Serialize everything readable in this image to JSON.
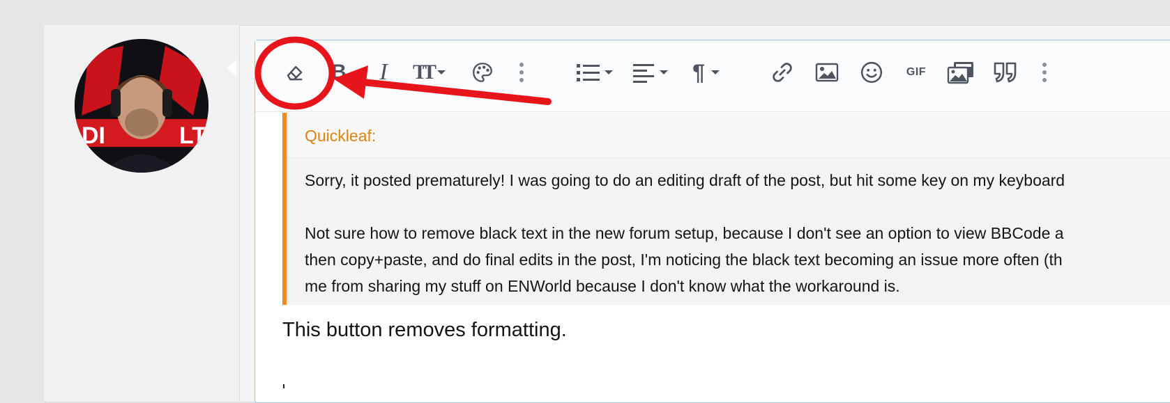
{
  "toolbar": {
    "buttons": [
      {
        "name": "remove-formatting-button",
        "icon": "eraser-icon"
      },
      {
        "name": "bold-button",
        "icon": "bold-icon",
        "glyph": "B"
      },
      {
        "name": "italic-button",
        "icon": "italic-icon",
        "glyph": "I"
      },
      {
        "name": "font-size-button",
        "icon": "font-size-icon",
        "glyph": "TT"
      },
      {
        "name": "text-color-button",
        "icon": "palette-icon"
      },
      {
        "name": "more-text-options-button",
        "icon": "vertical-ellipsis-icon"
      },
      {
        "name": "list-button",
        "icon": "list-icon"
      },
      {
        "name": "align-button",
        "icon": "align-left-icon"
      },
      {
        "name": "paragraph-button",
        "icon": "pilcrow-icon",
        "glyph": "¶"
      },
      {
        "name": "insert-link-button",
        "icon": "link-icon"
      },
      {
        "name": "insert-image-button",
        "icon": "image-icon"
      },
      {
        "name": "insert-smilie-button",
        "icon": "smiley-icon"
      },
      {
        "name": "insert-gif-button",
        "icon": "gif-icon",
        "glyph": "GIF"
      },
      {
        "name": "insert-media-button",
        "icon": "media-gallery-icon"
      },
      {
        "name": "insert-quote-button",
        "icon": "quote-icon",
        "glyph": "99"
      },
      {
        "name": "more-insert-options-button",
        "icon": "vertical-ellipsis-icon"
      }
    ]
  },
  "quote": {
    "author": "Quickleaf:",
    "paragraph1": "Sorry, it posted prematurely! I was going to do an editing draft of the post, but hit some key on my keyboard",
    "paragraph2_line1": "Not sure how to remove black text in the new forum setup, because I don't see an option to view BBCode a",
    "paragraph2_line2": "then copy+paste, and do final edits in the post, I'm noticing the black text becoming an issue more often (th",
    "paragraph2_line3": "me from sharing my stuff on ENWorld because I don't know what the workaround is."
  },
  "message": {
    "text": "This button removes formatting."
  },
  "annotation": {
    "color": "#e8141b",
    "shape": "circle-and-arrow"
  },
  "colors": {
    "accent_orange": "#ef8b21",
    "editor_border": "#9cc6e6",
    "icon_gray": "#4c5460"
  }
}
